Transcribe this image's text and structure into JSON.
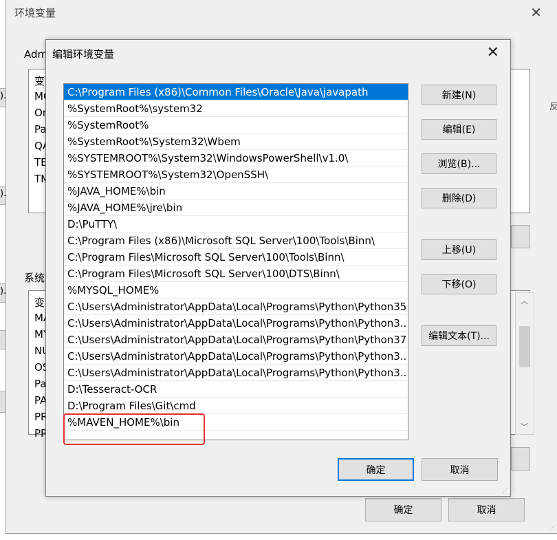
{
  "outer_dialog": {
    "title": "环境变量",
    "user_group_label": "Adm",
    "system_group_label": "系统",
    "user_vars": [
      "变",
      "MC",
      "On",
      "Pa",
      "QA",
      "TE",
      "TM"
    ],
    "system_vars": [
      "变",
      "MA",
      "MY",
      "NU",
      "OS",
      "Pa",
      "PA",
      "PR",
      "PR"
    ],
    "ok_label": "确定",
    "cancel_label": "取消"
  },
  "edge_fragments": [
    ").",
    ").",
    ").",
    "反"
  ],
  "edit_dialog": {
    "title": "编辑环境变量",
    "paths": [
      "C:\\Program Files (x86)\\Common Files\\Oracle\\Java\\javapath",
      "%SystemRoot%\\system32",
      "%SystemRoot%",
      "%SystemRoot%\\System32\\Wbem",
      "%SYSTEMROOT%\\System32\\WindowsPowerShell\\v1.0\\",
      "%SYSTEMROOT%\\System32\\OpenSSH\\",
      "%JAVA_HOME%\\bin",
      "%JAVA_HOME%\\jre\\bin",
      "D:\\PuTTY\\",
      "C:\\Program Files (x86)\\Microsoft SQL Server\\100\\Tools\\Binn\\",
      "C:\\Program Files\\Microsoft SQL Server\\100\\Tools\\Binn\\",
      "C:\\Program Files\\Microsoft SQL Server\\100\\DTS\\Binn\\",
      "%MYSQL_HOME%",
      "C:\\Users\\Administrator\\AppData\\Local\\Programs\\Python\\Python35",
      "C:\\Users\\Administrator\\AppData\\Local\\Programs\\Python\\Python3...",
      "C:\\Users\\Administrator\\AppData\\Local\\Programs\\Python\\Python37",
      "C:\\Users\\Administrator\\AppData\\Local\\Programs\\Python\\Python3...",
      "C:\\Users\\Administrator\\AppData\\Local\\Programs\\Python\\Python3...",
      "D:\\Tesseract-OCR",
      "D:\\Program Files\\Git\\cmd",
      "%MAVEN_HOME%\\bin"
    ],
    "selected_index": 0,
    "buttons": {
      "new": "新建(N)",
      "edit": "编辑(E)",
      "browse": "浏览(B)...",
      "delete": "删除(D)",
      "move_up": "上移(U)",
      "move_down": "下移(O)",
      "edit_text": "编辑文本(T)...",
      "ok": "确定",
      "cancel": "取消"
    }
  },
  "colors": {
    "selection": "#0078d7",
    "highlight_annotation": "#e03030"
  }
}
